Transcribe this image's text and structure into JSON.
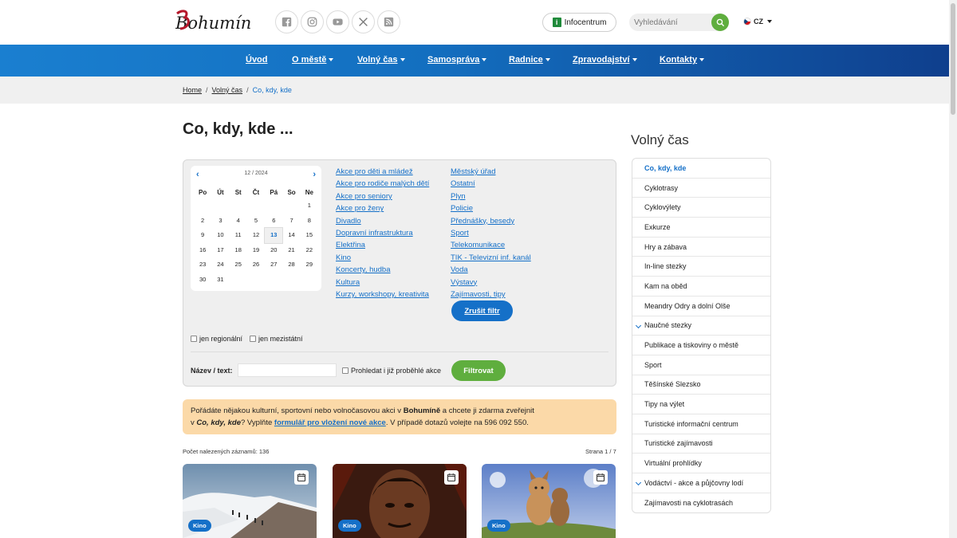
{
  "header": {
    "logo_text": "Bohumín",
    "social": [
      "facebook-icon",
      "instagram-icon",
      "youtube-icon",
      "x-icon",
      "rss-icon"
    ],
    "infocentrum_label": "Infocentrum",
    "search_placeholder": "Vyhledávání",
    "language": "CZ"
  },
  "nav": {
    "items": [
      {
        "label": "Úvod",
        "dropdown": false
      },
      {
        "label": "O městě",
        "dropdown": true
      },
      {
        "label": "Volný čas",
        "dropdown": true
      },
      {
        "label": "Samospráva",
        "dropdown": true
      },
      {
        "label": "Radnice",
        "dropdown": true
      },
      {
        "label": "Zpravodajství",
        "dropdown": true
      },
      {
        "label": "Kontakty",
        "dropdown": true
      }
    ]
  },
  "breadcrumb": {
    "items": [
      "Home",
      "Volný čas",
      "Co, kdy, kde"
    ],
    "separator": "/"
  },
  "main": {
    "title": "Co, kdy, kde ...",
    "calendar": {
      "month_label": "12 / 2024",
      "weekdays": [
        "Po",
        "Út",
        "St",
        "Čt",
        "Pá",
        "So",
        "Ne"
      ],
      "weeks": [
        [
          "",
          "",
          "",
          "",
          "",
          "",
          "1"
        ],
        [
          "2",
          "3",
          "4",
          "5",
          "6",
          "7",
          "8"
        ],
        [
          "9",
          "10",
          "11",
          "12",
          "13",
          "14",
          "15"
        ],
        [
          "16",
          "17",
          "18",
          "19",
          "20",
          "21",
          "22"
        ],
        [
          "23",
          "24",
          "25",
          "26",
          "27",
          "28",
          "29"
        ],
        [
          "30",
          "31",
          "",
          "",
          "",
          "",
          ""
        ]
      ],
      "today": "13"
    },
    "categories_col1": [
      "Akce pro děti a mládež",
      "Akce pro rodiče malých dětí",
      "Akce pro seniory",
      "Akce pro ženy",
      "Divadlo",
      "Dopravní infrastruktura",
      "Elektřina",
      "Kino",
      "Koncerty, hudba",
      "Kultura",
      "Kurzy, workshopy, kreativita"
    ],
    "categories_col2": [
      "Městský úřad",
      "Ostatní",
      "Plyn",
      "Policie",
      "Přednášky, besedy",
      "Sport",
      "Telekomunikace",
      "TIK - Televizní inf. kanál",
      "Voda",
      "Výstavy",
      "Zajímavosti, tipy"
    ],
    "clear_filter_label": "Zrušit filtr",
    "checkbox_regional": "jen regionální",
    "checkbox_international": "jen mezistátní",
    "text_label": "Název / text:",
    "checkbox_past": "Prohledat i již proběhlé akce",
    "filter_button": "Filtrovat",
    "notice": {
      "part1": "Pořádáte nějakou kulturní, sportovní nebo volnočasovou akci v ",
      "city": "Bohumíně",
      "part2": " a chcete ji zdarma zveřejnit",
      "part3": "v ",
      "section": "Co, kdy, kde",
      "part4": "? Vyplňte ",
      "link": "formulář pro vložení nové akce",
      "part5": ". V případě dotazů volejte na 596 092 550."
    },
    "results_count": "Počet nalezených záznamů: 136",
    "page_info": "Strana 1 / 7",
    "cards": [
      {
        "badge": "Kino",
        "image": "mountain-hikers-image"
      },
      {
        "badge": "Kino",
        "image": "wolverine-poster-image"
      },
      {
        "badge": "Kino",
        "image": "animated-animals-image"
      }
    ]
  },
  "sidebar": {
    "title": "Volný čas",
    "items": [
      {
        "label": "Co, kdy, kde",
        "active": true,
        "expandable": false
      },
      {
        "label": "Cyklotrasy",
        "active": false,
        "expandable": false
      },
      {
        "label": "Cyklovýlety",
        "active": false,
        "expandable": false
      },
      {
        "label": "Exkurze",
        "active": false,
        "expandable": false
      },
      {
        "label": "Hry a zábava",
        "active": false,
        "expandable": false
      },
      {
        "label": "In-line stezky",
        "active": false,
        "expandable": false
      },
      {
        "label": "Kam na oběd",
        "active": false,
        "expandable": false
      },
      {
        "label": "Meandry Odry a dolní Olše",
        "active": false,
        "expandable": false
      },
      {
        "label": "Naučné stezky",
        "active": false,
        "expandable": true
      },
      {
        "label": "Publikace a tiskoviny o městě",
        "active": false,
        "expandable": false
      },
      {
        "label": "Sport",
        "active": false,
        "expandable": false
      },
      {
        "label": "Těšínské Slezsko",
        "active": false,
        "expandable": false
      },
      {
        "label": "Tipy na výlet",
        "active": false,
        "expandable": false
      },
      {
        "label": "Turistické informační centrum",
        "active": false,
        "expandable": false
      },
      {
        "label": "Turistické zajímavosti",
        "active": false,
        "expandable": false
      },
      {
        "label": "Virtuální prohlídky",
        "active": false,
        "expandable": false
      },
      {
        "label": "Vodáctví - akce a půjčovny lodí",
        "active": false,
        "expandable": true
      },
      {
        "label": "Zajímavosti na cyklotrasách",
        "active": false,
        "expandable": false
      }
    ]
  },
  "colors": {
    "accent_blue": "#1570c8",
    "green": "#5fae3e",
    "nav_gradient_start": "#1a7fd0",
    "nav_gradient_end": "#0f3f8d",
    "notice_bg": "#fbd9a8",
    "logo_red": "#b5182b"
  }
}
